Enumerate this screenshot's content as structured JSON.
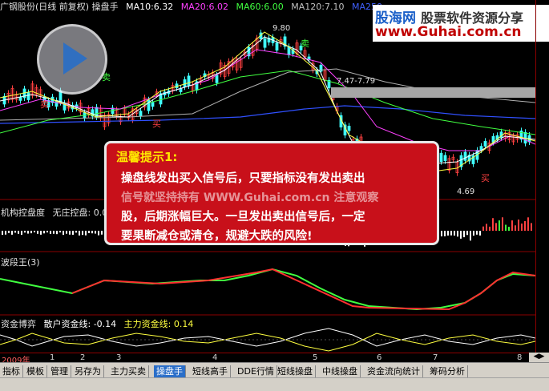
{
  "title": {
    "stock": "广钢股份(日线 前复权) 操盘手",
    "ma10": "MA10:6.32",
    "ma20": "MA20:6.02",
    "ma60": "MA60:6.00",
    "ma120": "MA120:7.10",
    "ma250": "MA250"
  },
  "colors": {
    "ma10": "#ffffff",
    "ma20": "#ff40ff",
    "ma60": "#40ff40",
    "ma120": "#c0c0c0",
    "ma250": "#4060ff",
    "up": "#ff4040",
    "down": "#40ffff"
  },
  "watermark": {
    "brand": "股海网",
    "slogan": "股票软件资源分享",
    "url": "www.Guhai.com.cn"
  },
  "price_labels": {
    "high": "9.80",
    "range": "7.47-7.79",
    "low": "4.69"
  },
  "signals": {
    "sell": "卖",
    "buy": "买"
  },
  "tip": {
    "title": "温馨提示1:",
    "body": "操盘线发出买入信号后，只要指标没有发出卖出信号就坚持持有，直到指标发出卖出信号。注意观察，一旦发出卖出信号后，一定要果断减仓或清仓，规避大跌的风险!",
    "line1": "操盘线发出买入信号后，只要指标没有发出卖出",
    "line2": "股，后期涨幅巨大。一旦发出卖出信号后，一定",
    "line3": "要果断减仓或清仓，规避大跌的风险!",
    "overlay": "信号就坚持持有 WWW.Guhai.com.cn 注意观察"
  },
  "panels": {
    "p2_name": "机构控盘度",
    "p2_sub": "无庄控盘: 0.0",
    "p3_name": "波段王(3)",
    "p4_name": "资金博弈",
    "p4_retail": "散户资金线: -0.14",
    "p4_main": "主力资金线: 0.14"
  },
  "axis": {
    "year": "2009年",
    "months": [
      "1",
      "2",
      "3",
      "4",
      "5",
      "6",
      "7",
      "8"
    ]
  },
  "tabs": [
    "指标",
    "模板",
    "管理",
    "另存为",
    "主力买卖",
    "操盘手",
    "短线高手",
    "DDE行情",
    "短线操盘",
    "中线操盘",
    "资金流向统计",
    "筹码分析"
  ],
  "active_tab": "操盘手"
}
